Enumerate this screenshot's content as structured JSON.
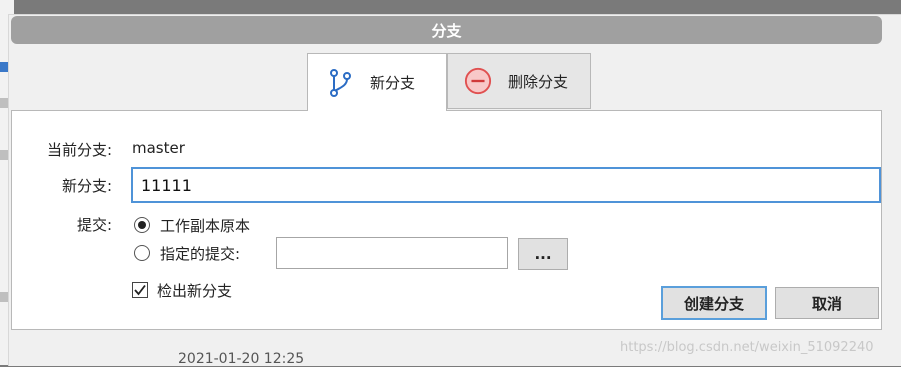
{
  "dialog": {
    "title": "分支",
    "tabs": [
      {
        "label": "新分支",
        "icon": "branch-icon",
        "active": true
      },
      {
        "label": "删除分支",
        "icon": "minus-circle-icon",
        "active": false
      }
    ],
    "current_branch": {
      "label": "当前分支:",
      "value": "master"
    },
    "new_branch": {
      "label": "新分支:",
      "value": "11111"
    },
    "commit": {
      "label": "提交:",
      "options": [
        {
          "label": "工作副本原本",
          "selected": true
        },
        {
          "label": "指定的提交:",
          "selected": false
        }
      ],
      "specified_commit_value": "",
      "browse_label": "..."
    },
    "checkout": {
      "label": "检出新分支",
      "checked": true
    },
    "buttons": {
      "create": "创建分支",
      "cancel": "取消"
    }
  },
  "background": {
    "date_fragment": "2021-01-20 12:25"
  },
  "watermark": "https://blog.csdn.net/weixin_51092240",
  "colors": {
    "title_bar": "#a0a0a0",
    "focus_border": "#4f93d8",
    "branch_icon": "#2b6cc4",
    "minus_circle": "#e05050"
  }
}
